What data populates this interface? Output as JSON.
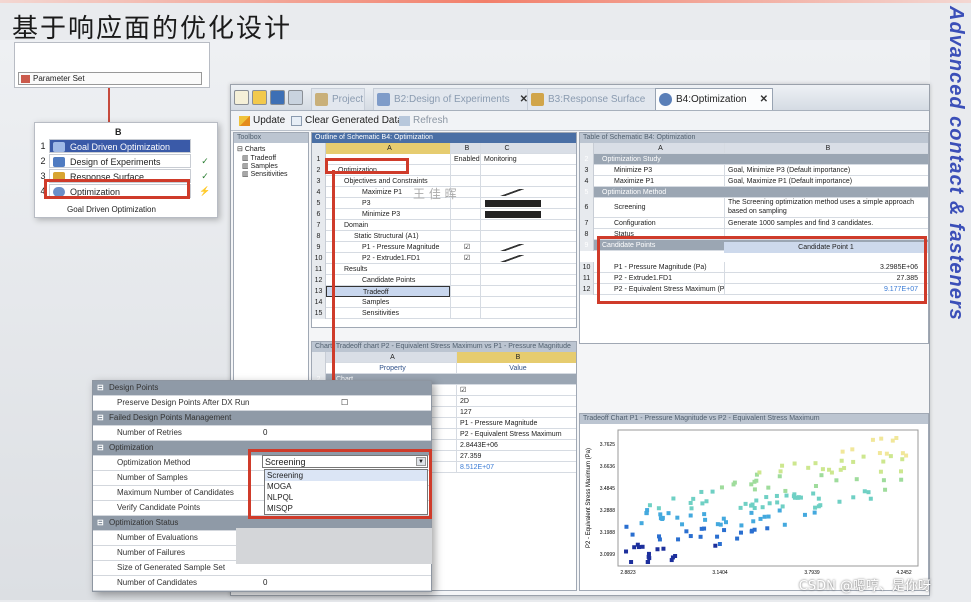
{
  "slide": {
    "title": "基于响应面的优化设计",
    "side_title": "Advanced contact & fasteners"
  },
  "schematic": {
    "param_set": "Parameter Set",
    "column": "B",
    "rows": [
      {
        "num": "1",
        "label": "Goal Driven Optimization",
        "selected": true,
        "color": "#3a5aa8"
      },
      {
        "num": "2",
        "label": "Design of Experiments",
        "check": "✓",
        "color": "#4f7bc1"
      },
      {
        "num": "3",
        "label": "Response Surface",
        "check": "✓",
        "color": "#d8a431"
      },
      {
        "num": "4",
        "label": "Optimization",
        "check": "⚡",
        "color": "#6b8fc9"
      }
    ],
    "footer": "Goal Driven Optimization"
  },
  "window": {
    "tabs": [
      {
        "label": "Project",
        "color": "#c9b07a"
      },
      {
        "label": "B2:Design of Experiments",
        "color": "#7f9cc9"
      },
      {
        "label": "B3:Response Surface",
        "color": "#d1a54a"
      },
      {
        "label": "B4:Optimization",
        "color": "#5a7fb8",
        "active": true
      }
    ],
    "toolbar": {
      "update": "Update",
      "clear": "Clear Generated Data",
      "refresh": "Refresh"
    },
    "toolbox": {
      "title": "Toolbox",
      "header": "Charts",
      "items": [
        "Tradeoff",
        "Samples",
        "Sensitivities"
      ]
    },
    "outline": {
      "title": "Outline of Schematic B4: Optimization",
      "cols": {
        "a": "A",
        "b": "B",
        "c": "C"
      },
      "header": {
        "num": "1",
        "a": "",
        "b": "Enabled",
        "c": "Monitoring"
      },
      "rows": [
        {
          "num": "2",
          "a": "Optimization",
          "kind": "sec"
        },
        {
          "num": "3",
          "a": "Objectives and Constraints",
          "kind": "sub"
        },
        {
          "num": "4",
          "a": "Maximize P1",
          "spark": true
        },
        {
          "num": "5",
          "a": "P3",
          "bar": true
        },
        {
          "num": "6",
          "a": "Minimize P3",
          "bar": true
        },
        {
          "num": "7",
          "a": "Domain",
          "kind": "sub"
        },
        {
          "num": "8",
          "a": "Static Structural (A1)",
          "kind": "sub2"
        },
        {
          "num": "9",
          "a": "P1 - Pressure Magnitude",
          "check": "☑",
          "spark": true
        },
        {
          "num": "10",
          "a": "P2 - Extrude1.FD1",
          "check": "☑",
          "spark": true
        },
        {
          "num": "11",
          "a": "Results",
          "kind": "sub"
        },
        {
          "num": "12",
          "a": "Candidate Points"
        },
        {
          "num": "13",
          "a": "Tradeoff",
          "selected": true
        },
        {
          "num": "14",
          "a": "Samples"
        },
        {
          "num": "15",
          "a": "Sensitivities"
        }
      ]
    },
    "table": {
      "title": "Table of Schematic B4: Optimization",
      "cols": {
        "a": "A",
        "b": "B"
      },
      "rows": [
        {
          "num": "2",
          "a": "Optimization Study",
          "kind": "sec"
        },
        {
          "num": "3",
          "a": "Minimize P3",
          "b": "Goal, Minimize P3 (Default importance)"
        },
        {
          "num": "4",
          "a": "Maximize P1",
          "b": "Goal, Maximize P1 (Default importance)"
        },
        {
          "num": "5",
          "a": "Optimization Method",
          "kind": "sec"
        },
        {
          "num": "6",
          "a": "Screening",
          "b": "The Screening optimization method uses a simple approach based on sampling"
        },
        {
          "num": "7",
          "a": "Configuration",
          "b": "Generate 1000 samples and find 3 candidates."
        },
        {
          "num": "8",
          "a": "Status",
          "b": ""
        },
        {
          "num": "9",
          "a": "Candidate Points",
          "kind": "sec"
        },
        {
          "num": "10",
          "a": "P1 - Pressure Magnitude (Pa)",
          "b": "3.2985E+06"
        },
        {
          "num": "11",
          "a": "P2 - Extrude1.FD1",
          "b": "27.385"
        },
        {
          "num": "12",
          "a": "P2 - Equivalent Stress Maximum (Pa)",
          "b": "9.177E+07"
        }
      ],
      "candidate_header": "Candidate Point 1"
    },
    "chart_props": {
      "title": "Chart: Tradeoff chart P2 - Equivalent Stress Maximum vs P1 - Pressure Magnitude",
      "cols": {
        "a": "A",
        "b": "B"
      },
      "header": {
        "a": "Property",
        "b": "Value"
      },
      "rows": [
        {
          "num": "2",
          "a": "Chart"
        },
        {
          "num": "3",
          "a": "",
          "b": "☑"
        },
        {
          "num": "",
          "a": "",
          "b": "2D"
        },
        {
          "num": "",
          "a": "",
          "b": "127"
        },
        {
          "num": "",
          "a": "",
          "b": "P1 - Pressure Magnitude"
        },
        {
          "num": "",
          "a": "",
          "b": "P2 - Equivalent Stress Maximum"
        },
        {
          "num": "",
          "a": "",
          "b": "2.8443E+06"
        },
        {
          "num": "",
          "a": "",
          "b": "27.359"
        },
        {
          "num": "",
          "a": "",
          "b": "8.512E+07"
        }
      ]
    },
    "scatter": {
      "title": "Tradeoff Chart P1 - Pressure Magnitude vs P2 - Equivalent Stress Maximum",
      "ylabel": "P2 - Equivalent Stress Maximum (Pa)",
      "xticks": [
        "2.8823",
        "3.1404",
        "3.7939",
        "4.2452"
      ],
      "yticks": [
        "3.7625",
        "3.6636",
        "3.4845",
        "3.2888",
        "3.1988",
        "3.0999"
      ]
    }
  },
  "props": {
    "sections": [
      {
        "label": "Design Points"
      },
      {
        "label": "Failed Design Points Management"
      },
      {
        "label": "Optimization"
      },
      {
        "label": "Optimization Status"
      }
    ],
    "rows": [
      {
        "label": "Preserve Design Points After DX Run",
        "value": "☐"
      },
      {
        "label": "Number of Retries",
        "value": "0"
      },
      {
        "label": "Optimization Method",
        "value": "Screening"
      },
      {
        "label": "Number of Samples",
        "value": ""
      },
      {
        "label": "Maximum Number of Candidates",
        "value": ""
      },
      {
        "label": "Verify Candidate Points",
        "value": ""
      },
      {
        "label": "Number of Evaluations",
        "value": ""
      },
      {
        "label": "Number of Failures",
        "value": ""
      },
      {
        "label": "Size of Generated Sample Set",
        "value": ""
      },
      {
        "label": "Number of Candidates",
        "value": "0"
      }
    ],
    "dropdown": [
      "Screening",
      "MOGA",
      "NLPQL",
      "MISQP"
    ]
  },
  "watermark": "CSDN @嗯哼、是你呀",
  "chinese_stamp": "王 佳 晖",
  "colors": {
    "red_highlight": "#cf3b2a",
    "section_gray": "#9ba6b3",
    "selected": "#e9c768"
  }
}
